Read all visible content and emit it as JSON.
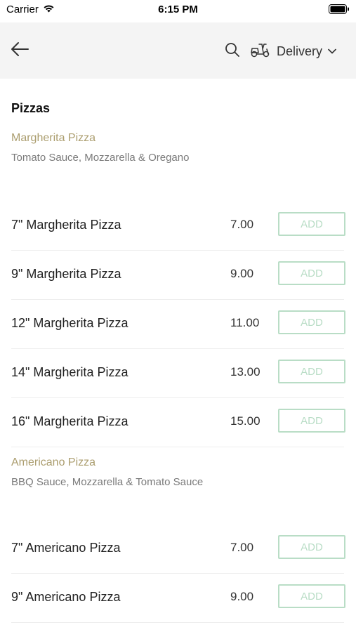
{
  "status_bar": {
    "carrier": "Carrier",
    "time": "6:15 PM"
  },
  "header": {
    "back_icon": "arrow-left-icon",
    "search_icon": "search-icon",
    "delivery_icon": "scooter-icon",
    "delivery_label": "Delivery",
    "dropdown_icon": "chevron-down-icon"
  },
  "menu": {
    "category": "Pizzas",
    "products": [
      {
        "name": "Margherita Pizza",
        "description": "Tomato Sauce, Mozzarella & Oregano",
        "variants": [
          {
            "name": "7\" Margherita Pizza",
            "price": "7.00",
            "button": "ADD"
          },
          {
            "name": "9\" Margherita Pizza",
            "price": "9.00",
            "button": "ADD"
          },
          {
            "name": "12\" Margherita Pizza",
            "price": "11.00",
            "button": "ADD"
          },
          {
            "name": "14\" Margherita Pizza",
            "price": "13.00",
            "button": "ADD"
          },
          {
            "name": "16\" Margherita Pizza",
            "price": "15.00",
            "button": "ADD"
          }
        ]
      },
      {
        "name": "Americano Pizza",
        "description": "BBQ Sauce, Mozzarella & Tomato Sauce",
        "variants": [
          {
            "name": "7\" Americano Pizza",
            "price": "7.00",
            "button": "ADD"
          },
          {
            "name": "9\" Americano Pizza",
            "price": "9.00",
            "button": "ADD"
          }
        ]
      }
    ]
  },
  "colors": {
    "header_bg": "#f4f4f4",
    "product_name": "#ab9d6e",
    "add_button": "#b9ddc6"
  }
}
